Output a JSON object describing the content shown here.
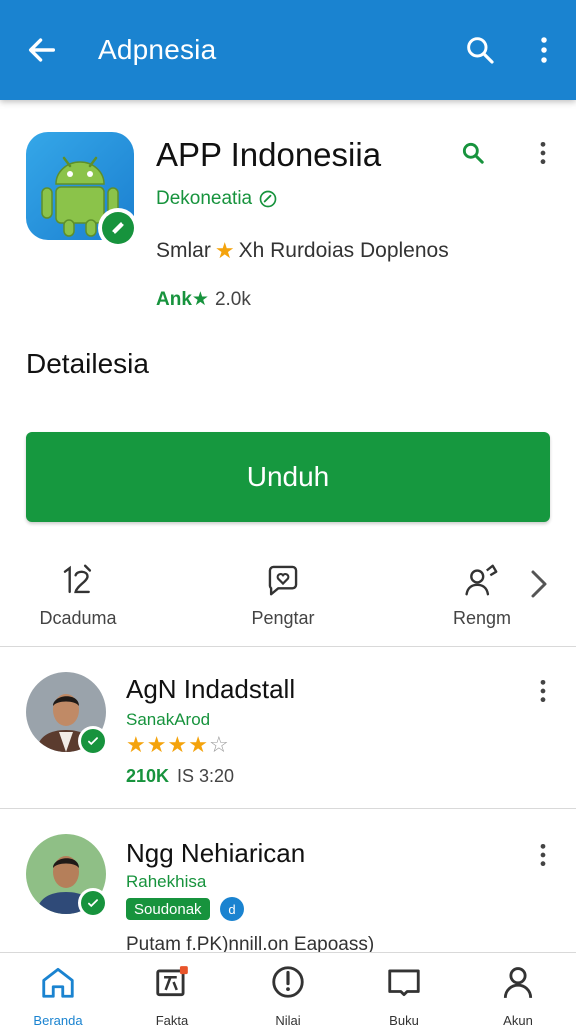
{
  "appbar": {
    "title": "Adpnesia",
    "back_icon": "arrow-left-icon",
    "search_icon": "search-icon",
    "more_icon": "more-vert-icon",
    "color": "#1a83d0"
  },
  "app": {
    "name": "APP Indonesiia",
    "developer": "Dekoneatia",
    "meta_prefix": "Smlar",
    "meta_suffix": "Xh Rurdoias Doplenos",
    "rating_label": "Ank★",
    "downloads": "2.0k",
    "icon": "android-robot-icon",
    "badge_icon": "verified-badge-icon"
  },
  "details": {
    "section_title": "Detailesia",
    "install_label": "Unduh",
    "install_color": "#16983f"
  },
  "actions": [
    {
      "label": "Dcaduma",
      "icon": "number-12-icon"
    },
    {
      "label": "Pengtar",
      "icon": "heart-chat-icon"
    },
    {
      "label": "Rengm",
      "icon": "share-person-icon"
    }
  ],
  "reviews": [
    {
      "name": "AgN Indadstall",
      "subtitle": "SanakArod",
      "stars": 4,
      "rating_value": "210K",
      "date": "IS 3:20"
    },
    {
      "name": "Ngg Nehiarican",
      "subtitle": "Rahekhisa",
      "chip": "Soudonak",
      "chip_badge": "d",
      "text": "Putam f.PK)nnill.on Eapoass)"
    }
  ],
  "bottom_nav": [
    {
      "label": "Beranda",
      "icon": "home-icon",
      "active": true
    },
    {
      "label": "Fakta",
      "icon": "news-badge-icon",
      "active": false
    },
    {
      "label": "Nilai",
      "icon": "compass-icon",
      "active": false
    },
    {
      "label": "Buku",
      "icon": "book-icon",
      "active": false
    },
    {
      "label": "Akun",
      "icon": "person-icon",
      "active": false
    }
  ]
}
